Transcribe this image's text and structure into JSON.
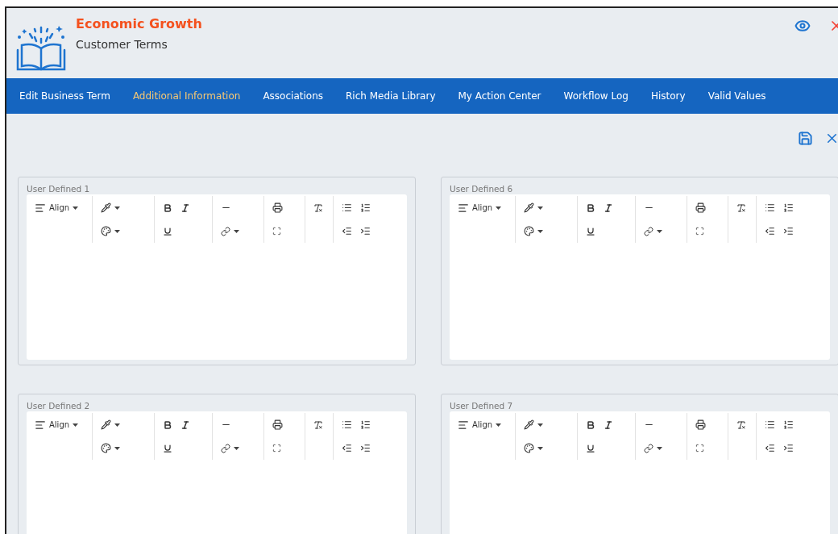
{
  "header": {
    "title": "Economic Growth",
    "subtitle": "Customer Terms"
  },
  "tabs": [
    {
      "label": "Edit Business Term",
      "selected": false
    },
    {
      "label": "Additional Information",
      "selected": true
    },
    {
      "label": "Associations",
      "selected": false
    },
    {
      "label": "Rich Media Library",
      "selected": false
    },
    {
      "label": "My Action Center",
      "selected": false
    },
    {
      "label": "Workflow Log",
      "selected": false
    },
    {
      "label": "History",
      "selected": false
    },
    {
      "label": "Valid Values",
      "selected": false
    }
  ],
  "editors": [
    {
      "label": "User Defined 1",
      "align_label": "Align"
    },
    {
      "label": "User Defined 6",
      "align_label": "Align"
    },
    {
      "label": "User Defined 2",
      "align_label": "Align"
    },
    {
      "label": "User Defined 7",
      "align_label": "Align"
    }
  ]
}
